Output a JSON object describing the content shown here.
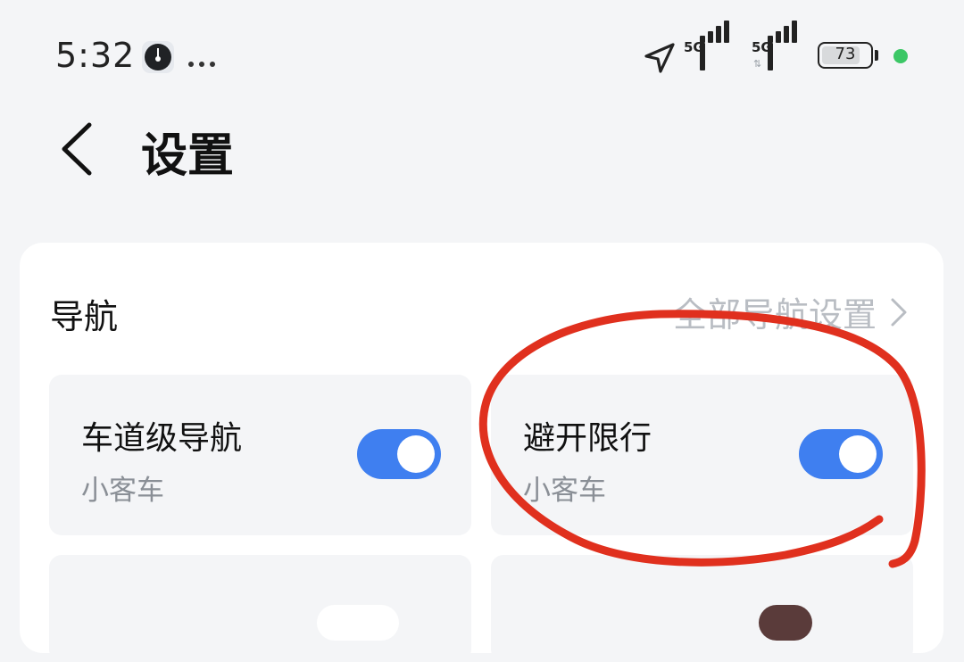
{
  "status_bar": {
    "time": "5:32",
    "signal_1_label": "5G",
    "signal_2_label": "5G",
    "battery_level": "73",
    "icons": [
      "clock-app-icon",
      "more-dots-icon",
      "location-arrow-icon",
      "signal-5g-icon",
      "signal-5g-icon",
      "battery-icon",
      "green-dot-indicator"
    ]
  },
  "header": {
    "back_icon": "chevron-left-icon",
    "title": "设置"
  },
  "navigation_section": {
    "title": "导航",
    "all_settings_label": "全部导航设置",
    "all_settings_icon": "chevron-right-icon",
    "tiles": [
      {
        "title": "车道级导航",
        "subtitle": "小客车",
        "toggle_on": true
      },
      {
        "title": "避开限行",
        "subtitle": "小客车",
        "toggle_on": true
      }
    ]
  },
  "colors": {
    "background": "#f4f5f7",
    "card": "#ffffff",
    "toggle_on": "#3f7ff0",
    "annotation_red": "#e0301e",
    "link_gray": "#b9bdc3",
    "subtitle_gray": "#8a8f96"
  }
}
